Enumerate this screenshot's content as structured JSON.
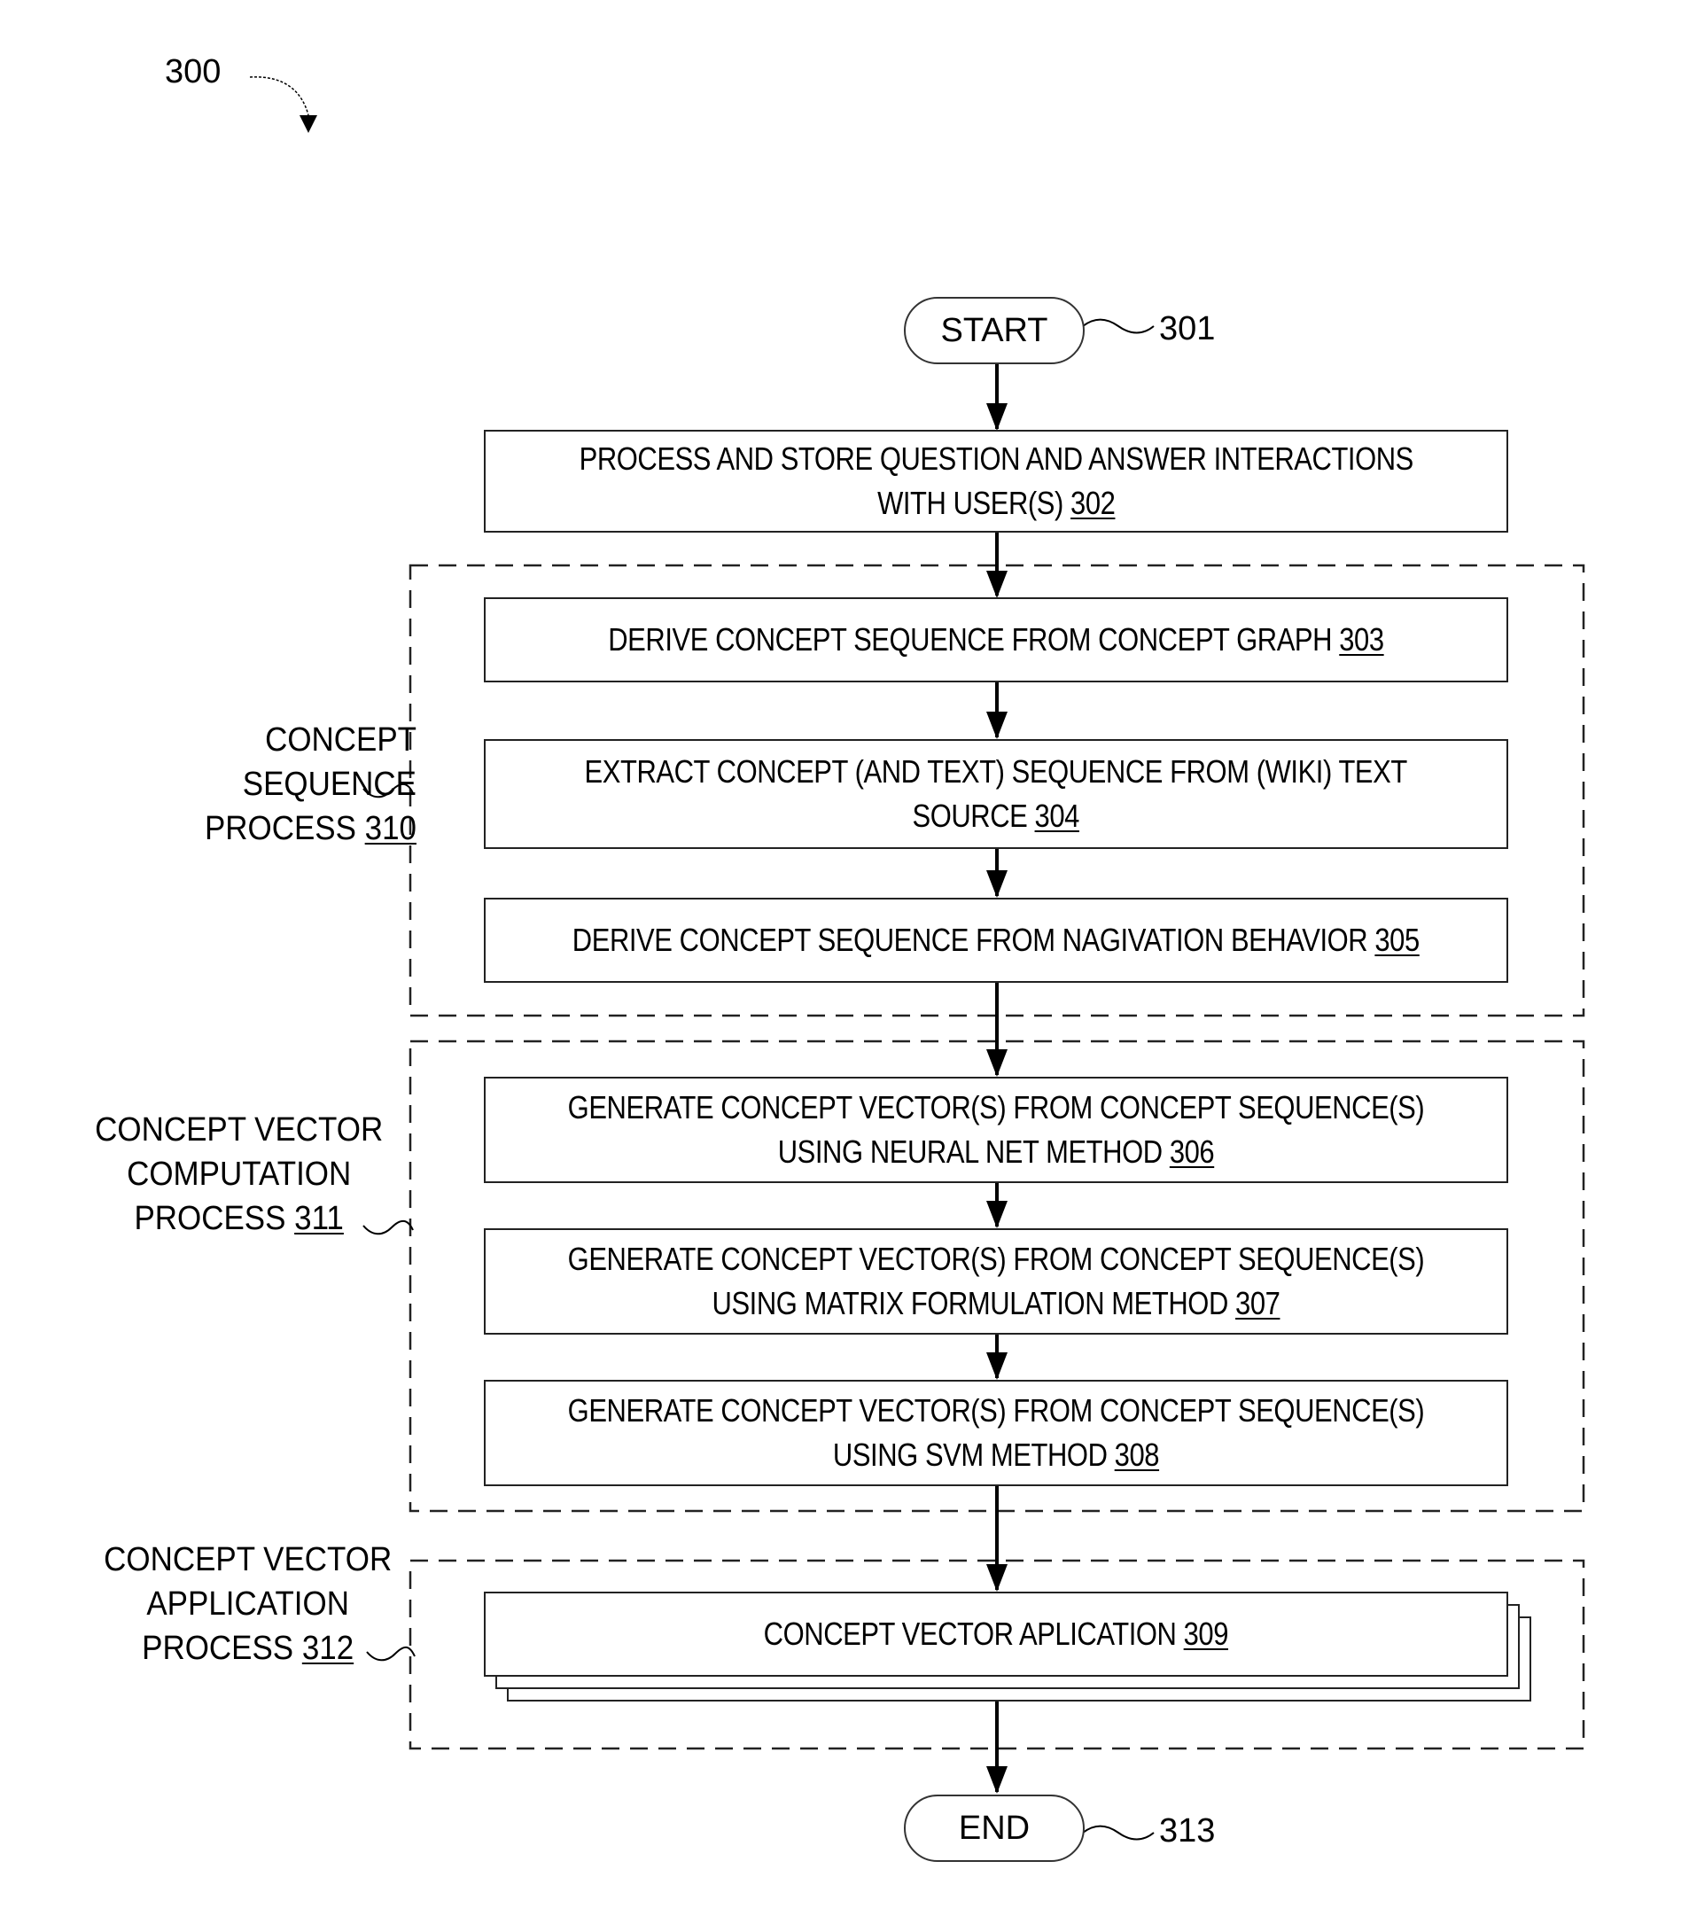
{
  "figure": {
    "number": "300"
  },
  "terminals": {
    "start": {
      "label": "START",
      "ref": "301"
    },
    "end": {
      "label": "END",
      "ref": "313"
    }
  },
  "steps": [
    {
      "text": "PROCESS AND STORE QUESTION AND ANSWER INTERACTIONS\nWITH USER(S) ",
      "ref": "302"
    },
    {
      "text": "DERIVE CONCEPT SEQUENCE FROM CONCEPT GRAPH ",
      "ref": "303"
    },
    {
      "text": "EXTRACT CONCEPT (AND TEXT) SEQUENCE  FROM (WIKI) TEXT\nSOURCE ",
      "ref": "304"
    },
    {
      "text": "DERIVE CONCEPT SEQUENCE FROM NAGIVATION BEHAVIOR ",
      "ref": "305"
    },
    {
      "text": "GENERATE CONCEPT VECTOR(S) FROM CONCEPT SEQUENCE(S)\nUSING NEURAL NET METHOD ",
      "ref": "306"
    },
    {
      "text": "GENERATE CONCEPT VECTOR(S) FROM CONCEPT SEQUENCE(S)\nUSING MATRIX FORMULATION METHOD ",
      "ref": "307"
    },
    {
      "text": "GENERATE CONCEPT VECTOR(S) FROM CONCEPT SEQUENCE(S)\nUSING SVM METHOD ",
      "ref": "308"
    },
    {
      "text": "CONCEPT VECTOR APLICATION ",
      "ref": "309"
    }
  ],
  "groups": [
    {
      "label": "CONCEPT SEQUENCE\nPROCESS ",
      "ref": "310"
    },
    {
      "label": "CONCEPT VECTOR\nCOMPUTATION\nPROCESS ",
      "ref": "311"
    },
    {
      "label": "CONCEPT VECTOR\nAPPLICATION\nPROCESS ",
      "ref": "312"
    }
  ]
}
